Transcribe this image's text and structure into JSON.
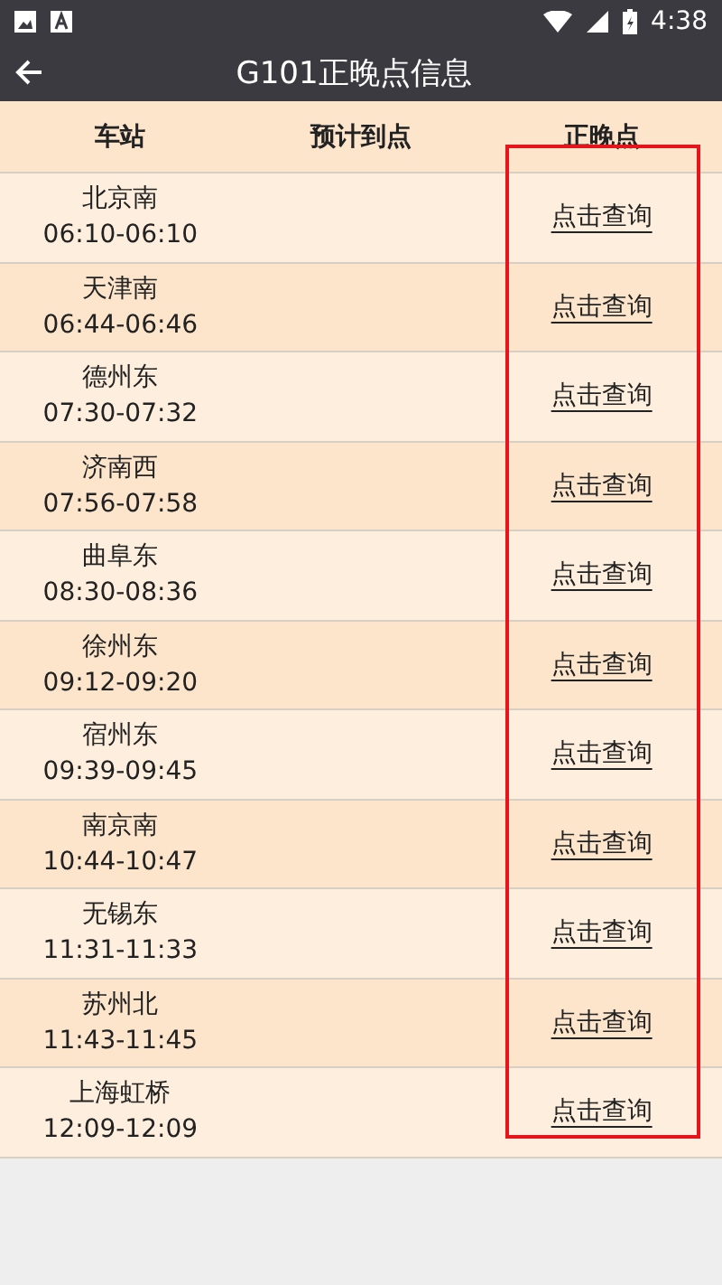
{
  "status_bar": {
    "time": "4:38"
  },
  "app_bar": {
    "title": "G101正晚点信息"
  },
  "table": {
    "columns": [
      "车站",
      "预计到点",
      "正晚点"
    ],
    "rows": [
      {
        "station": "北京南",
        "time": "06:10-06:10",
        "action": "点击查询"
      },
      {
        "station": "天津南",
        "time": "06:44-06:46",
        "action": "点击查询"
      },
      {
        "station": "德州东",
        "time": "07:30-07:32",
        "action": "点击查询"
      },
      {
        "station": "济南西",
        "time": "07:56-07:58",
        "action": "点击查询"
      },
      {
        "station": "曲阜东",
        "time": "08:30-08:36",
        "action": "点击查询"
      },
      {
        "station": "徐州东",
        "time": "09:12-09:20",
        "action": "点击查询"
      },
      {
        "station": "宿州东",
        "time": "09:39-09:45",
        "action": "点击查询"
      },
      {
        "station": "南京南",
        "time": "10:44-10:47",
        "action": "点击查询"
      },
      {
        "station": "无锡东",
        "time": "11:31-11:33",
        "action": "点击查询"
      },
      {
        "station": "苏州北",
        "time": "11:43-11:45",
        "action": "点击查询"
      },
      {
        "station": "上海虹桥",
        "time": "12:09-12:09",
        "action": "点击查询"
      }
    ]
  },
  "highlight": {
    "kind": "annotation-box"
  }
}
